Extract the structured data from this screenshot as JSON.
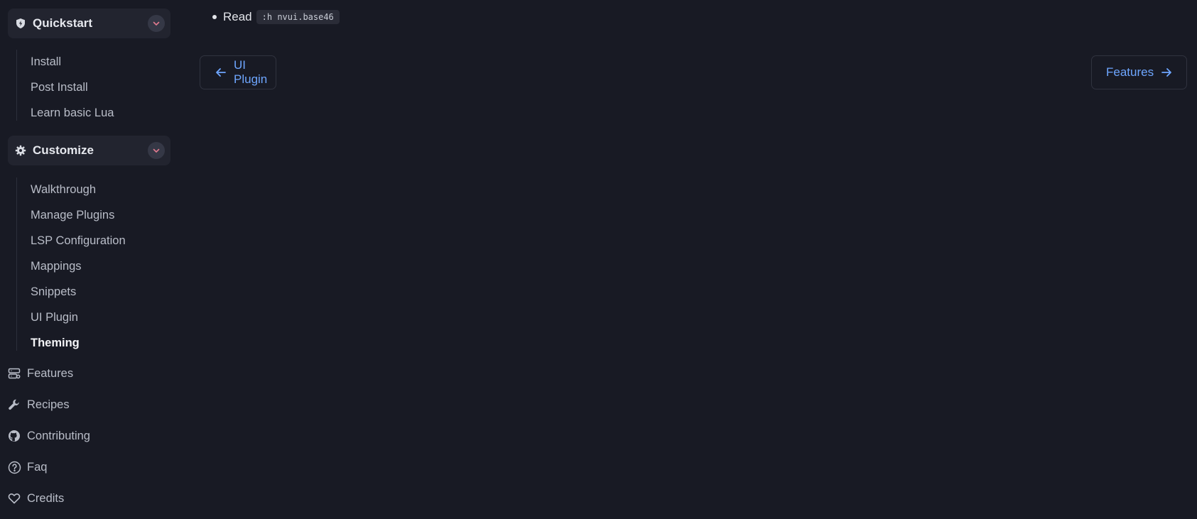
{
  "sidebar": {
    "groups": [
      {
        "label": "Quickstart",
        "icon": "shield-icon",
        "items": [
          {
            "label": "Install",
            "active": false
          },
          {
            "label": "Post Install",
            "active": false
          },
          {
            "label": "Learn basic Lua",
            "active": false
          }
        ]
      },
      {
        "label": "Customize",
        "icon": "gear-icon",
        "items": [
          {
            "label": "Walkthrough",
            "active": false
          },
          {
            "label": "Manage Plugins",
            "active": false
          },
          {
            "label": "LSP Configuration",
            "active": false
          },
          {
            "label": "Mappings",
            "active": false
          },
          {
            "label": "Snippets",
            "active": false
          },
          {
            "label": "UI Plugin",
            "active": false
          },
          {
            "label": "Theming",
            "active": true
          }
        ]
      }
    ],
    "links": [
      {
        "label": "Features",
        "icon": "server-icon"
      },
      {
        "label": "Recipes",
        "icon": "wrench-icon"
      },
      {
        "label": "Contributing",
        "icon": "github-icon"
      },
      {
        "label": "Faq",
        "icon": "question-circle-icon"
      },
      {
        "label": "Credits",
        "icon": "heart-icon"
      }
    ]
  },
  "main": {
    "read_text": "Read",
    "read_code": ":h nvui.base46",
    "prev_label": "UI Plugin",
    "next_label": "Features"
  },
  "colors": {
    "background": "#181a24",
    "accent": "#6ea6ff",
    "chevron": "#e07a8f"
  }
}
